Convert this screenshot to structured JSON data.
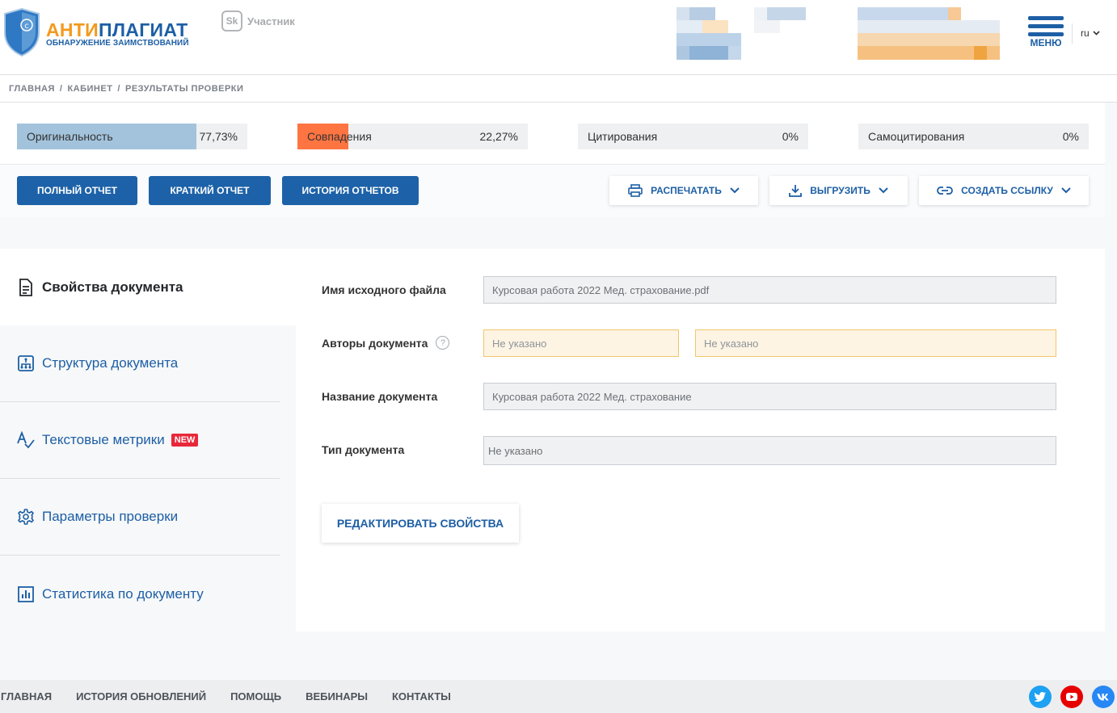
{
  "header": {
    "logo_title_part1": "АНТИ",
    "logo_title_part2": "ПЛАГИАТ",
    "logo_subtitle": "ОБНАРУЖЕНИЕ ЗАИМСТВОВАНИЙ",
    "sk_badge": "Sk",
    "sk_label": "Участник",
    "menu_label": "МЕНЮ",
    "language": "ru"
  },
  "breadcrumb": [
    "ГЛАВНАЯ",
    "КАБИНЕТ",
    "РЕЗУЛЬТАТЫ ПРОВЕРКИ"
  ],
  "stats": {
    "originality": {
      "label": "Оригинальность",
      "value": "77,73%",
      "fraction": 0.7773,
      "color": "#a3c3dc"
    },
    "matches": {
      "label": "Совпадения",
      "value": "22,27%",
      "fraction": 0.2227,
      "color": "#ff7542"
    },
    "citations": {
      "label": "Цитирования",
      "value": "0%",
      "fraction": 0
    },
    "self_citations": {
      "label": "Самоцитирования",
      "value": "0%",
      "fraction": 0
    }
  },
  "actions": {
    "full_report": "ПОЛНЫЙ ОТЧЕТ",
    "short_report": "КРАТКИЙ ОТЧЕТ",
    "report_history": "ИСТОРИЯ ОТЧЕТОВ",
    "print": "РАСПЕЧАТАТЬ",
    "export": "ВЫГРУЗИТЬ",
    "create_link": "СОЗДАТЬ ССЫЛКУ"
  },
  "sidenav": {
    "doc_properties": "Свойства документа",
    "doc_structure": "Структура документа",
    "text_metrics": "Текстовые метрики",
    "new_badge": "NEW",
    "check_params": "Параметры проверки",
    "doc_stats": "Статистика по документу"
  },
  "properties": {
    "file_name_label": "Имя исходного файла",
    "file_name_value": "Курсовая работа 2022 Мед. страхование.pdf",
    "authors_label": "Авторы документа",
    "help_symbol": "?",
    "author1_value": "Не указано",
    "author2_value": "Не указано",
    "title_label": "Название документа",
    "title_value": "Курсовая работа 2022 Мед. страхование",
    "type_label": "Тип документа",
    "type_value": "Не указано",
    "edit_button": "РЕДАКТИРОВАТЬ СВОЙСТВА"
  },
  "footer": {
    "links": [
      "ГЛАВНАЯ",
      "ИСТОРИЯ ОБНОВЛЕНИЙ",
      "ПОМОЩЬ",
      "ВЕБИНАРЫ",
      "КОНТАКТЫ"
    ],
    "socials": [
      {
        "name": "twitter-icon",
        "color": "#1da1f2"
      },
      {
        "name": "youtube-icon",
        "color": "#e60000"
      },
      {
        "name": "vk-icon",
        "color": "#2787f5"
      }
    ]
  }
}
